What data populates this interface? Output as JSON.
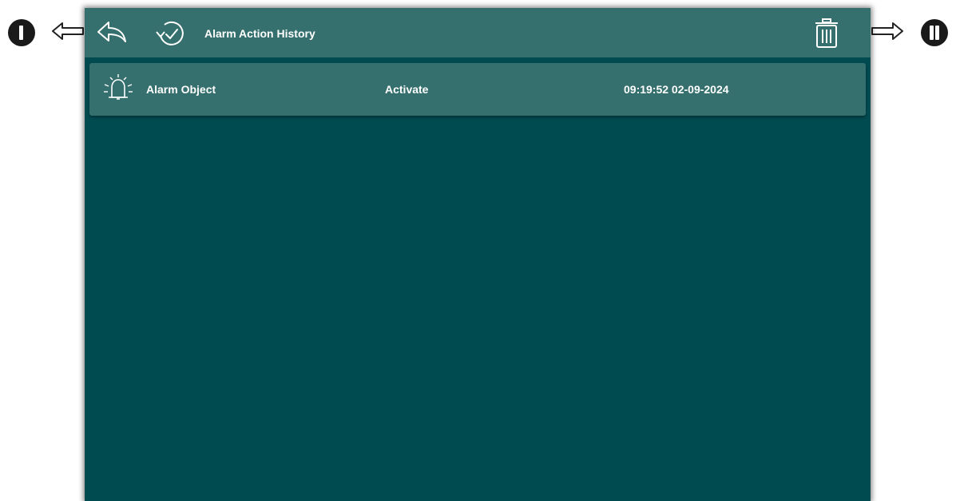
{
  "callouts": {
    "left": "I",
    "right": "II"
  },
  "header": {
    "title": "Alarm Action History",
    "icons": [
      "back-icon",
      "history-icon",
      "trash-icon"
    ]
  },
  "history": {
    "rows": [
      {
        "icon": "bell-icon",
        "object": "Alarm Object",
        "action": "Activate",
        "time": "09:19:52 02-09-2024"
      }
    ]
  },
  "colors": {
    "background": "#004b50",
    "bar": "#35706e",
    "text": "#ffffff"
  }
}
